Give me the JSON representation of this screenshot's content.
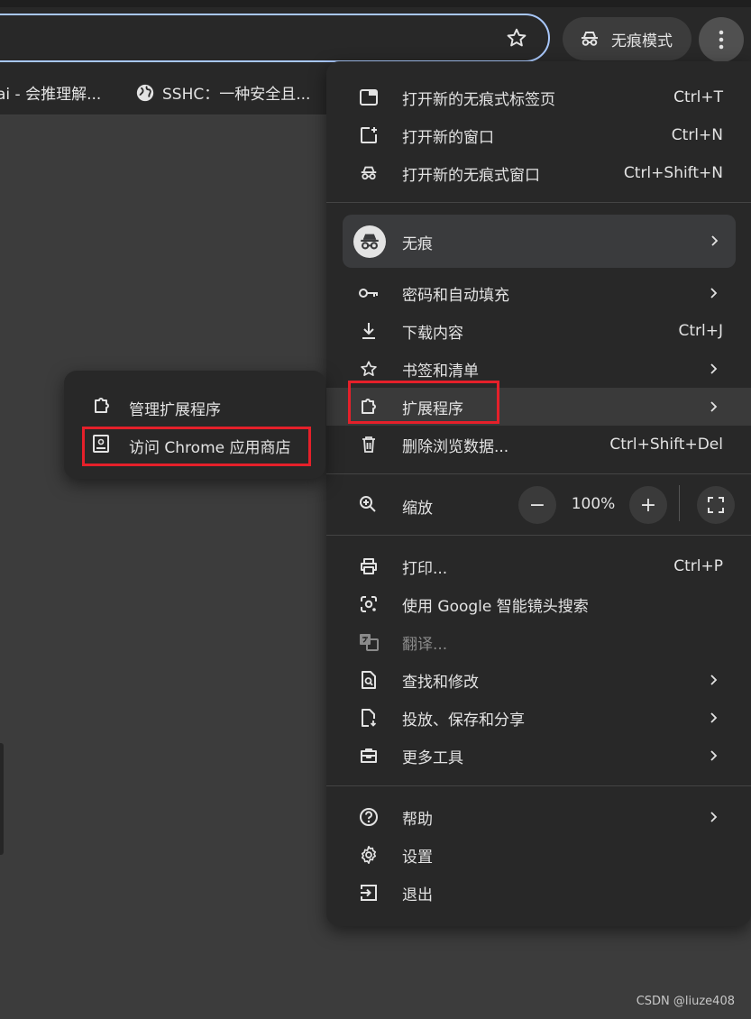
{
  "toolbar": {
    "incognito_label": "无痕模式"
  },
  "bookmarks": [
    {
      "label": "ai - 会推理解..."
    },
    {
      "label": "SSHC：一种安全且..."
    }
  ],
  "menu": {
    "group1": [
      {
        "label": "打开新的无痕式标签页",
        "shortcut": "Ctrl+T",
        "icon": "new-tab-icon"
      },
      {
        "label": "打开新的窗口",
        "shortcut": "Ctrl+N",
        "icon": "new-window-icon"
      },
      {
        "label": "打开新的无痕式窗口",
        "shortcut": "Ctrl+Shift+N",
        "icon": "incognito-icon"
      }
    ],
    "profile": {
      "label": "无痕"
    },
    "group2": [
      {
        "label": "密码和自动填充",
        "icon": "key-icon"
      },
      {
        "label": "下载内容",
        "shortcut": "Ctrl+J",
        "icon": "download-icon"
      },
      {
        "label": "书签和清单",
        "icon": "star-icon"
      },
      {
        "label": "扩展程序",
        "icon": "puzzle-icon"
      },
      {
        "label": "删除浏览数据...",
        "shortcut": "Ctrl+Shift+Del",
        "icon": "trash-icon"
      }
    ],
    "zoom": {
      "label": "缩放",
      "value": "100%",
      "minus": "−",
      "plus": "+"
    },
    "group3": [
      {
        "label": "打印...",
        "shortcut": "Ctrl+P",
        "icon": "printer-icon"
      },
      {
        "label": "使用 Google 智能镜头搜索",
        "icon": "lens-icon"
      },
      {
        "label": "翻译...",
        "icon": "translate-icon"
      },
      {
        "label": "查找和修改",
        "icon": "find-icon"
      },
      {
        "label": "投放、保存和分享",
        "icon": "cast-icon"
      },
      {
        "label": "更多工具",
        "icon": "toolbox-icon"
      }
    ],
    "group4": [
      {
        "label": "帮助",
        "icon": "help-icon"
      },
      {
        "label": "设置",
        "icon": "gear-icon"
      },
      {
        "label": "退出",
        "icon": "exit-icon"
      }
    ]
  },
  "submenu": [
    {
      "label": "管理扩展程序",
      "icon": "puzzle-icon"
    },
    {
      "label": "访问 Chrome 应用商店",
      "icon": "store-icon"
    }
  ],
  "watermark": "CSDN @liuze408"
}
